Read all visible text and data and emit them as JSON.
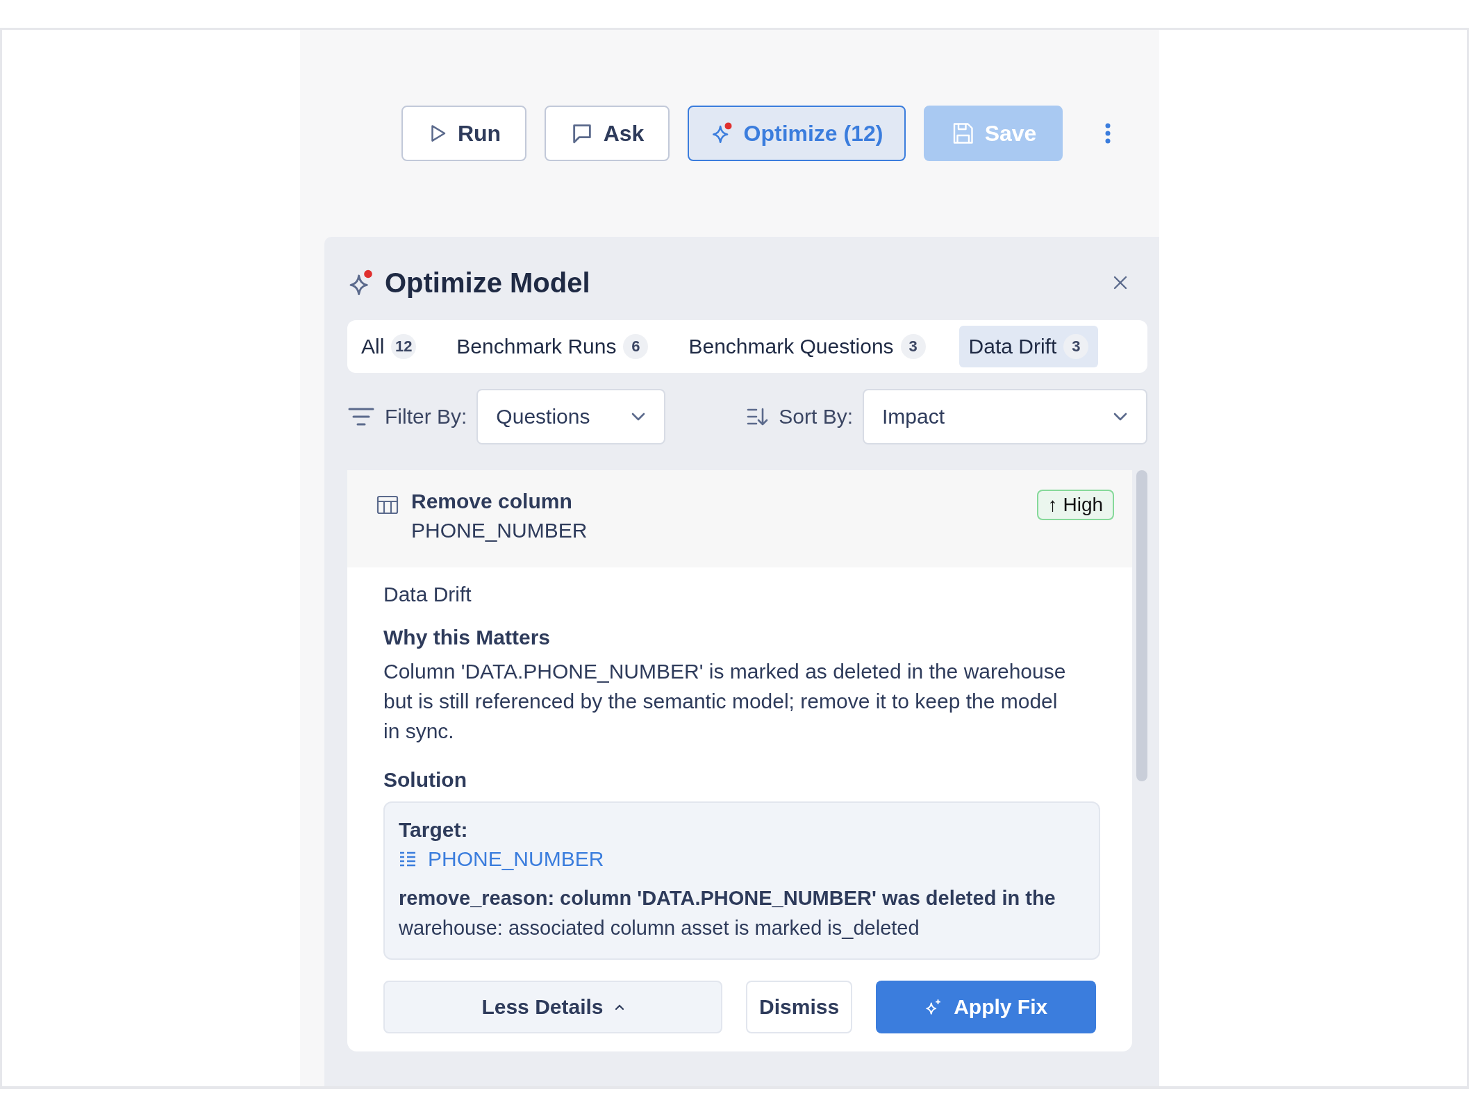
{
  "toolbar": {
    "buttons": [
      {
        "kind": "run",
        "label": "Run",
        "selected": false,
        "disabled": false
      },
      {
        "kind": "ask",
        "label": "Ask",
        "selected": false,
        "disabled": false
      },
      {
        "kind": "optimize",
        "label": "Optimize (12)",
        "selected": true,
        "disabled": false,
        "notification": true
      },
      {
        "kind": "save",
        "label": "Save",
        "selected": false,
        "disabled": true
      }
    ]
  },
  "panel": {
    "title": "Optimize Model",
    "notification": true,
    "tabs": [
      {
        "label": "All",
        "count": "12",
        "selected": false
      },
      {
        "label": "Benchmark Runs",
        "count": "6",
        "selected": false
      },
      {
        "label": "Benchmark Questions",
        "count": "3",
        "selected": false
      },
      {
        "label": "Data Drift",
        "count": "3",
        "selected": true
      }
    ],
    "filter": {
      "label": "Filter By:",
      "value": "Questions"
    },
    "sort": {
      "label": "Sort By:",
      "value": "Impact"
    },
    "suggestion": {
      "title": "Remove column",
      "subtitle": "PHONE_NUMBER",
      "impact": "↑ High",
      "expanded": true,
      "category": "Data Drift",
      "why_heading": "Why this Matters",
      "why_text": "Column 'DATA.PHONE_NUMBER' is marked as deleted in the warehouse but is still referenced by the semantic model; remove it to keep the model in sync.",
      "solution_heading": "Solution",
      "target_label": "Target:",
      "target_value": "PHONE_NUMBER",
      "reason": "**remove_reason: column 'DATA.PHONE_NUMBER' was deleted in the** warehouse: associated column asset is marked is_deleted",
      "actions": [
        {
          "kind": "toggle",
          "label": "Less Details"
        },
        {
          "kind": "dismiss",
          "label": "Dismiss"
        },
        {
          "kind": "apply",
          "label": "Apply Fix"
        }
      ]
    }
  }
}
